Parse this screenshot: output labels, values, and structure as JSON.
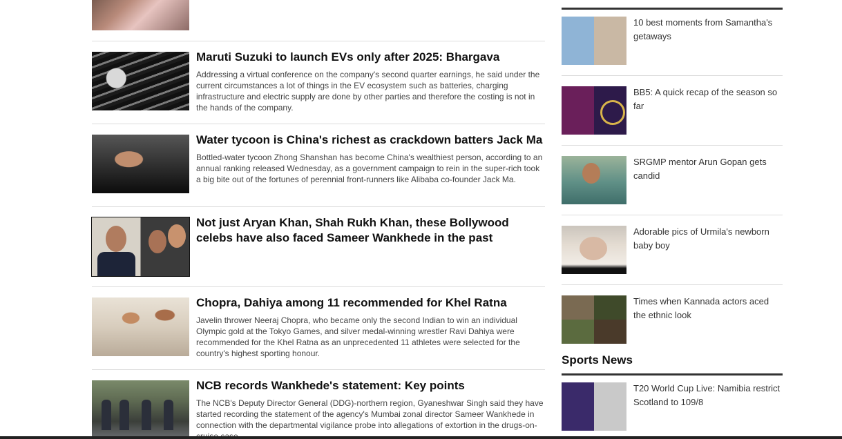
{
  "main": {
    "stories": [
      {
        "title": "Maruti Suzuki to launch EVs only after 2025: Bhargava",
        "summary": "Addressing a virtual conference on the company's second quarter earnings, he said under the current circumstances a lot of things in the EV ecosystem such as batteries, charging infrastructure and electric supply are done by other parties and therefore the costing is not in the hands of the company."
      },
      {
        "title": "Water tycoon is China's richest as crackdown batters Jack Ma",
        "summary": "Bottled-water tycoon Zhong Shanshan has become China's wealthiest person, according to an annual ranking released Wednesday, as a government campaign to rein in the super-rich took a big bite out of the fortunes of perennial front-runners like Alibaba co-founder Jack Ma."
      },
      {
        "title": "Not just Aryan Khan, Shah Rukh Khan, these Bollywood celebs have also faced Sameer Wankhede in the past",
        "summary": ""
      },
      {
        "title": "Chopra, Dahiya among 11 recommended for Khel Ratna",
        "summary": "Javelin thrower Neeraj Chopra, who became only the second Indian to win an individual Olympic gold at the Tokyo Games, and silver medal-winning wrestler Ravi Dahiya were recommended for the Khel Ratna as an unprecedented 11 athletes were selected for the country's highest sporting honour."
      },
      {
        "title": "NCB records Wankhede's statement: Key points",
        "summary": "The NCB's Deputy Director General (DDG)-northern region, Gyaneshwar Singh said they have started recording the statement of the agency's Mumbai zonal director Sameer Wankhede in connection with the departmental vigilance probe into allegations of extortion in the drugs-on-cruise case."
      }
    ]
  },
  "sidebar": {
    "items": [
      {
        "title": "10 best moments from Samantha's getaways"
      },
      {
        "title": "BB5: A quick recap of the season so far"
      },
      {
        "title": "SRGMP mentor Arun Gopan gets candid"
      },
      {
        "title": "Adorable pics of Urmila's newborn baby boy"
      },
      {
        "title": "Times when Kannada actors aced the ethnic look"
      }
    ],
    "sports_heading": "Sports News",
    "sports_items": [
      {
        "title": "T20 World Cup Live: Namibia restrict Scotland to 109/8"
      }
    ]
  }
}
